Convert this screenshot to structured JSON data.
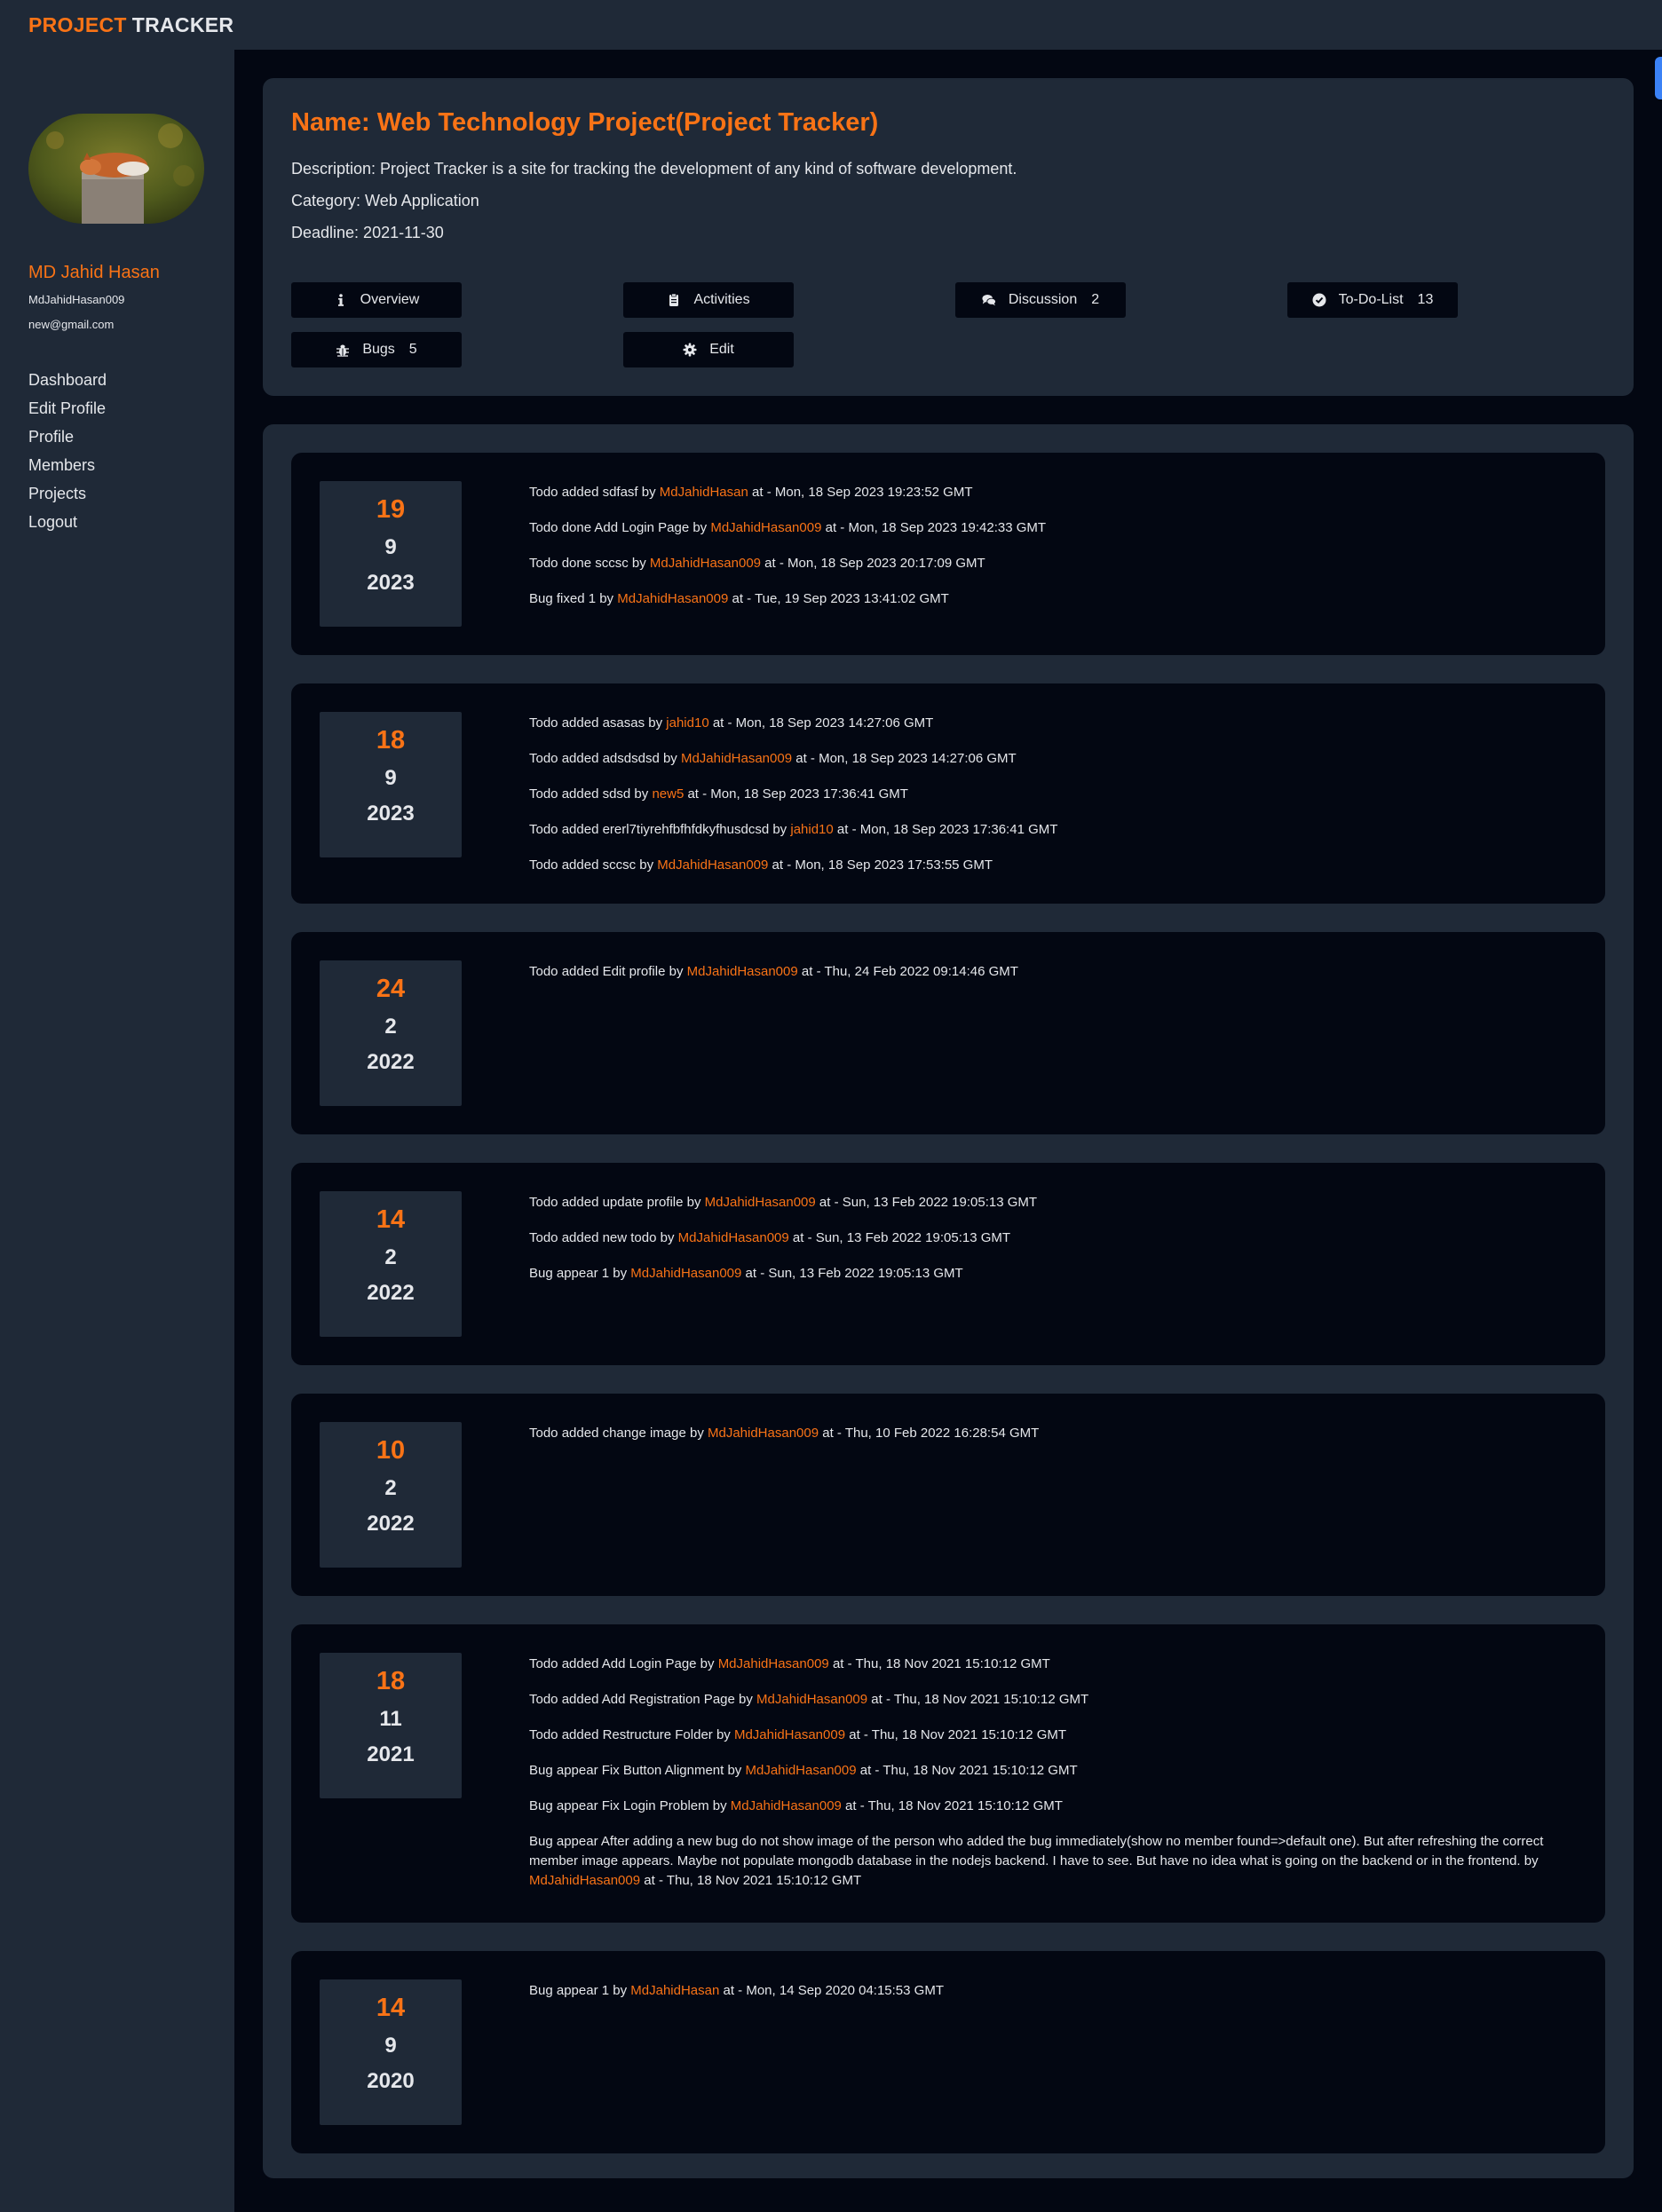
{
  "brand": {
    "part1": "PROJECT",
    "part2": "TRACKER"
  },
  "user": {
    "name": "MD Jahid Hasan",
    "handle": "MdJahidHasan009",
    "email": "new@gmail.com"
  },
  "nav": [
    "Dashboard",
    "Edit Profile",
    "Profile",
    "Members",
    "Projects",
    "Logout"
  ],
  "project": {
    "title": "Name: Web Technology Project(Project Tracker)",
    "description": "Description: Project Tracker is a site for tracking the development of any kind of software development.",
    "category": "Category: Web Application",
    "deadline": "Deadline: 2021-11-30"
  },
  "buttons": {
    "overview": {
      "label": "Overview",
      "icon": "info-icon"
    },
    "activities": {
      "label": "Activities",
      "icon": "clipboard-icon"
    },
    "discussion": {
      "label": "Discussion",
      "count": "2",
      "icon": "comments-icon"
    },
    "todo": {
      "label": "To-Do-List",
      "count": "13",
      "icon": "check-circle-icon"
    },
    "bugs": {
      "label": "Bugs",
      "count": "5",
      "icon": "bug-icon"
    },
    "edit": {
      "label": "Edit",
      "icon": "gear-icon"
    }
  },
  "days": [
    {
      "day": "19",
      "month": "9",
      "year": "2023",
      "entries": [
        {
          "text": "Todo added sdfasf by ",
          "user": "MdJahidHasan",
          "at": " at - Mon, 18 Sep 2023 19:23:52 GMT"
        },
        {
          "text": "Todo done Add Login Page by ",
          "user": "MdJahidHasan009",
          "at": " at - Mon, 18 Sep 2023 19:42:33 GMT"
        },
        {
          "text": "Todo done sccsc by ",
          "user": "MdJahidHasan009",
          "at": " at - Mon, 18 Sep 2023 20:17:09 GMT"
        },
        {
          "text": "Bug fixed 1 by ",
          "user": "MdJahidHasan009",
          "at": " at - Tue, 19 Sep 2023 13:41:02 GMT"
        }
      ]
    },
    {
      "day": "18",
      "month": "9",
      "year": "2023",
      "entries": [
        {
          "text": "Todo added asasas by ",
          "user": "jahid10",
          "at": " at - Mon, 18 Sep 2023 14:27:06 GMT"
        },
        {
          "text": "Todo added adsdsdsd by ",
          "user": "MdJahidHasan009",
          "at": " at - Mon, 18 Sep 2023 14:27:06 GMT"
        },
        {
          "text": "Todo added sdsd by ",
          "user": "new5",
          "at": " at - Mon, 18 Sep 2023 17:36:41 GMT"
        },
        {
          "text": "Todo added ererl7tiyrehfbfhfdkyfhusdcsd by ",
          "user": "jahid10",
          "at": " at - Mon, 18 Sep 2023 17:36:41 GMT"
        },
        {
          "text": "Todo added sccsc by ",
          "user": "MdJahidHasan009",
          "at": " at - Mon, 18 Sep 2023 17:53:55 GMT"
        }
      ]
    },
    {
      "day": "24",
      "month": "2",
      "year": "2022",
      "entries": [
        {
          "text": "Todo added Edit profile by ",
          "user": "MdJahidHasan009",
          "at": " at - Thu, 24 Feb 2022 09:14:46 GMT"
        }
      ]
    },
    {
      "day": "14",
      "month": "2",
      "year": "2022",
      "entries": [
        {
          "text": "Todo added update profile by ",
          "user": "MdJahidHasan009",
          "at": " at - Sun, 13 Feb 2022 19:05:13 GMT"
        },
        {
          "text": "Todo added new todo by ",
          "user": "MdJahidHasan009",
          "at": " at - Sun, 13 Feb 2022 19:05:13 GMT"
        },
        {
          "text": "Bug appear 1 by ",
          "user": "MdJahidHasan009",
          "at": " at - Sun, 13 Feb 2022 19:05:13 GMT"
        }
      ]
    },
    {
      "day": "10",
      "month": "2",
      "year": "2022",
      "entries": [
        {
          "text": "Todo added change image by ",
          "user": "MdJahidHasan009",
          "at": " at - Thu, 10 Feb 2022 16:28:54 GMT"
        }
      ]
    },
    {
      "day": "18",
      "month": "11",
      "year": "2021",
      "entries": [
        {
          "text": "Todo added Add Login Page by ",
          "user": "MdJahidHasan009",
          "at": " at - Thu, 18 Nov 2021 15:10:12 GMT"
        },
        {
          "text": "Todo added Add Registration Page by ",
          "user": "MdJahidHasan009",
          "at": " at - Thu, 18 Nov 2021 15:10:12 GMT"
        },
        {
          "text": "Todo added Restructure Folder by ",
          "user": "MdJahidHasan009",
          "at": " at - Thu, 18 Nov 2021 15:10:12 GMT"
        },
        {
          "text": "Bug appear Fix Button Alignment by ",
          "user": "MdJahidHasan009",
          "at": " at - Thu, 18 Nov 2021 15:10:12 GMT"
        },
        {
          "text": "Bug appear Fix Login Problem by ",
          "user": "MdJahidHasan009",
          "at": " at - Thu, 18 Nov 2021 15:10:12 GMT"
        },
        {
          "text": "Bug appear After adding a new bug do not show image of the person who added the bug immediately(show no member found=>default one). But after refreshing the correct member image appears. Maybe not populate mongodb database in the nodejs backend. I have to see. But have no idea what is going on the backend or in the frontend. by ",
          "user": "MdJahidHasan009",
          "at": " at - Thu, 18 Nov 2021 15:10:12 GMT"
        }
      ]
    },
    {
      "day": "14",
      "month": "9",
      "year": "2020",
      "entries": [
        {
          "text": "Bug appear 1 by ",
          "user": "MdJahidHasan",
          "at": " at - Mon, 14 Sep 2020 04:15:53 GMT"
        }
      ]
    }
  ]
}
